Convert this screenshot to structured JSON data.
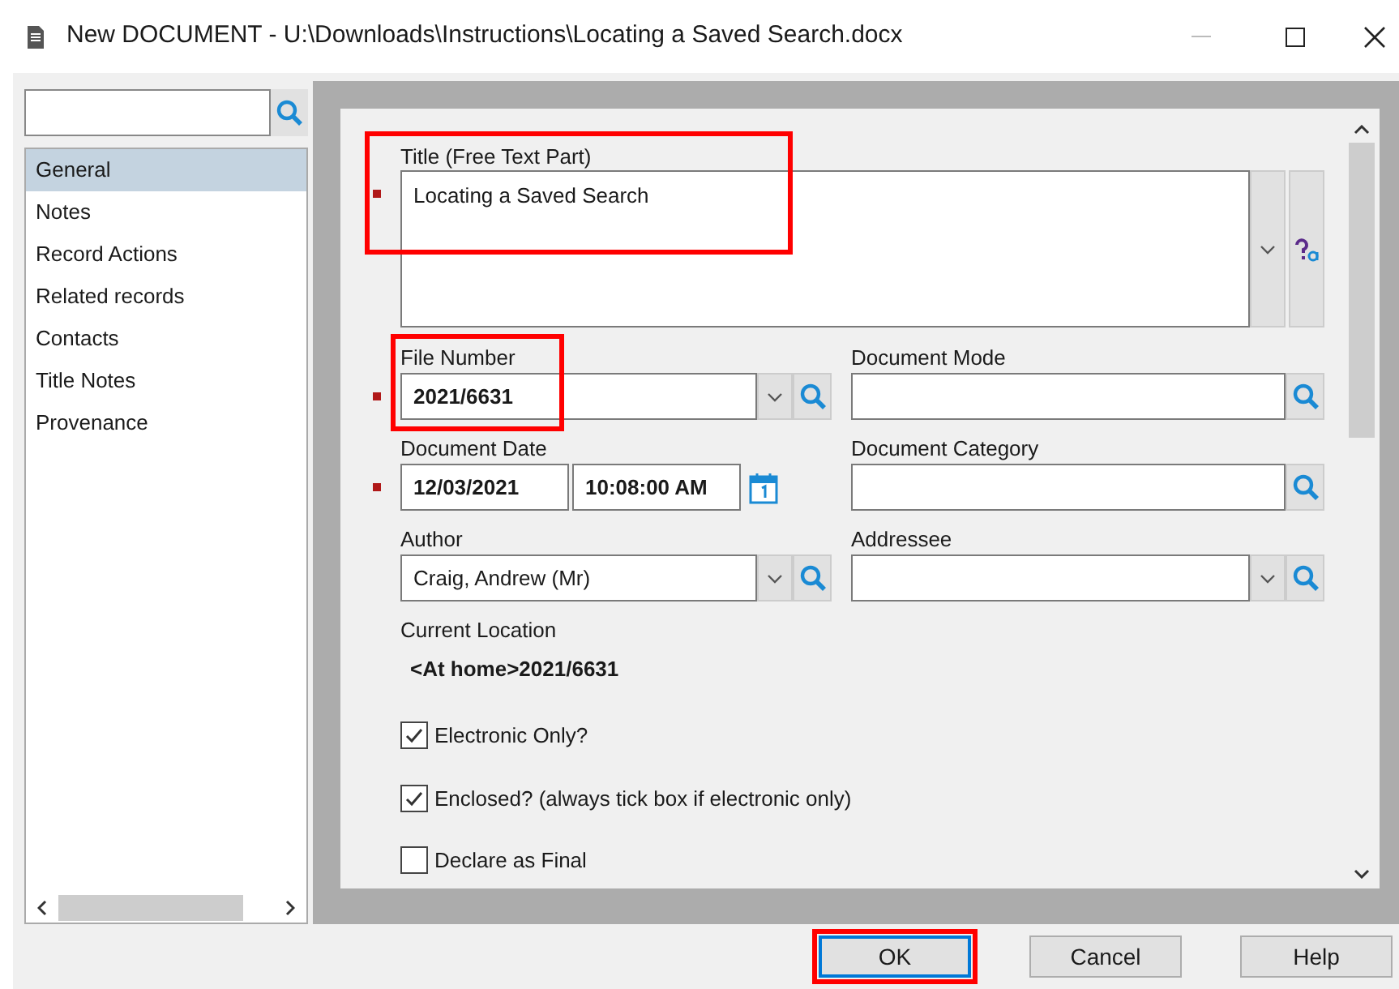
{
  "window": {
    "title": "New DOCUMENT - U:\\Downloads\\Instructions\\Locating a Saved Search.docx"
  },
  "sidebar": {
    "items": [
      {
        "label": "General",
        "selected": true
      },
      {
        "label": "Notes",
        "selected": false
      },
      {
        "label": "Record Actions",
        "selected": false
      },
      {
        "label": "Related records",
        "selected": false
      },
      {
        "label": "Contacts",
        "selected": false
      },
      {
        "label": "Title Notes",
        "selected": false
      },
      {
        "label": "Provenance",
        "selected": false
      }
    ]
  },
  "form": {
    "title_field": {
      "label": "Title (Free Text Part)",
      "value": "Locating a Saved Search",
      "required": true,
      "highlighted": true
    },
    "file_number": {
      "label": "File Number",
      "value": "2021/6631",
      "required": true,
      "highlighted": true
    },
    "document_mode": {
      "label": "Document Mode"
    },
    "document_date": {
      "label": "Document Date",
      "date": "12/03/2021",
      "time": "10:08:00 AM",
      "required": true
    },
    "document_category": {
      "label": "Document Category"
    },
    "author": {
      "label": "Author",
      "value": "Craig, Andrew (Mr)"
    },
    "addressee": {
      "label": "Addressee"
    },
    "current_location": {
      "label": "Current Location",
      "value": "<At home>2021/6631"
    },
    "checkboxes": [
      {
        "label": "Electronic Only?",
        "checked": true
      },
      {
        "label": "Enclosed? (always tick box if electronic only)",
        "checked": true
      },
      {
        "label": "Declare as Final",
        "checked": false
      }
    ]
  },
  "buttons": [
    {
      "label": "OK",
      "focused": true,
      "highlighted": true
    },
    {
      "label": "Cancel",
      "focused": false,
      "highlighted": false
    },
    {
      "label": "Help",
      "focused": false,
      "highlighted": false
    }
  ]
}
